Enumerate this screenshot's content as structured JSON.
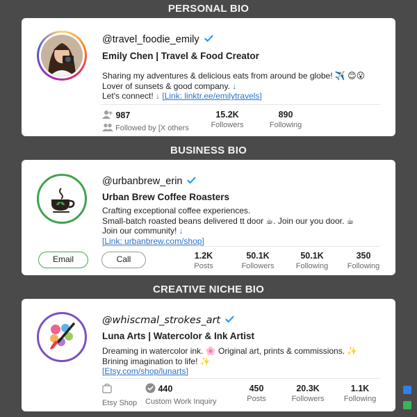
{
  "sections": {
    "personal_title": "PERSONAL BIO",
    "business_title": "BUSINESS BIO",
    "creative_title": "CREATIVE NICHE BIO"
  },
  "personal": {
    "handle": "@travel_foodie_emily",
    "name": "Emily Chen | Travel & Food Creator",
    "bio_line1": "Sharing my adventures & delicious eats from around be globe! ✈️ 😊😮",
    "bio_line2": "Lover of sunsets & good company.",
    "bio_line3": "Let's connect!",
    "link": "[Link: linktr.ee/emilytravels]",
    "stats": {
      "mutual_num": "987",
      "mutual_label": "Followed by [X others",
      "followers_num": "15.2K",
      "followers_label": "Followers",
      "following_num": "890",
      "following_label": "Following"
    },
    "icons": [
      "person-add-icon",
      "people-icon",
      "verified-badge-icon",
      "camera-icon"
    ]
  },
  "business": {
    "handle": "@urbanbrew_erin",
    "name": "Urban Brew Coffee Roasters",
    "bio_line1": "Crafting exceptional coffee experiences.",
    "bio_line2": "Small-batch roasted beans delivered tt door ☕. Join our you door. ☕",
    "bio_line3": "Join our community!",
    "link": "[Link: urbanbrew.com/shop]",
    "email_button": "Email",
    "call_button": "Call",
    "stats": [
      {
        "num": "1.2K",
        "label": "Posts"
      },
      {
        "num": "50.1K",
        "label": "Followers"
      },
      {
        "num": "50.1K",
        "label": "Following"
      },
      {
        "num": "350",
        "label": "Following"
      }
    ],
    "icons": [
      "coffee-cup-icon",
      "verified-badge-icon"
    ]
  },
  "creative": {
    "handle": "@whiscmal_strokes_art",
    "name": "Luna Arts | Watercolor & Ink Artist",
    "bio_line1": "Dreaming in watercolor ink. 🌸 Original art, prints & commissions. ✨",
    "bio_line2": "Brining imagination to life! ✨",
    "link": "[Etsy.com/shop/lunarts]",
    "etsy_label": "Etsy Shop",
    "inquiry_num": "440",
    "inquiry_label": "Custom Work Inquiry",
    "stats": [
      {
        "num": "450",
        "label": "Posts"
      },
      {
        "num": "20.3K",
        "label": "Followers"
      },
      {
        "num": "1.1K",
        "label": "Following"
      }
    ],
    "icons": [
      "paintbrush-icon",
      "shop-icon",
      "check-circle-icon",
      "verified-badge-icon"
    ]
  },
  "colors": {
    "background": "#4a4a4b",
    "verified": "#1d9bf0",
    "link": "#2b74c9",
    "business_ring": "#3fa34d",
    "creative_ring": "#7b4fc4",
    "square_blue": "#2f80ed",
    "square_green": "#3cb25a"
  }
}
